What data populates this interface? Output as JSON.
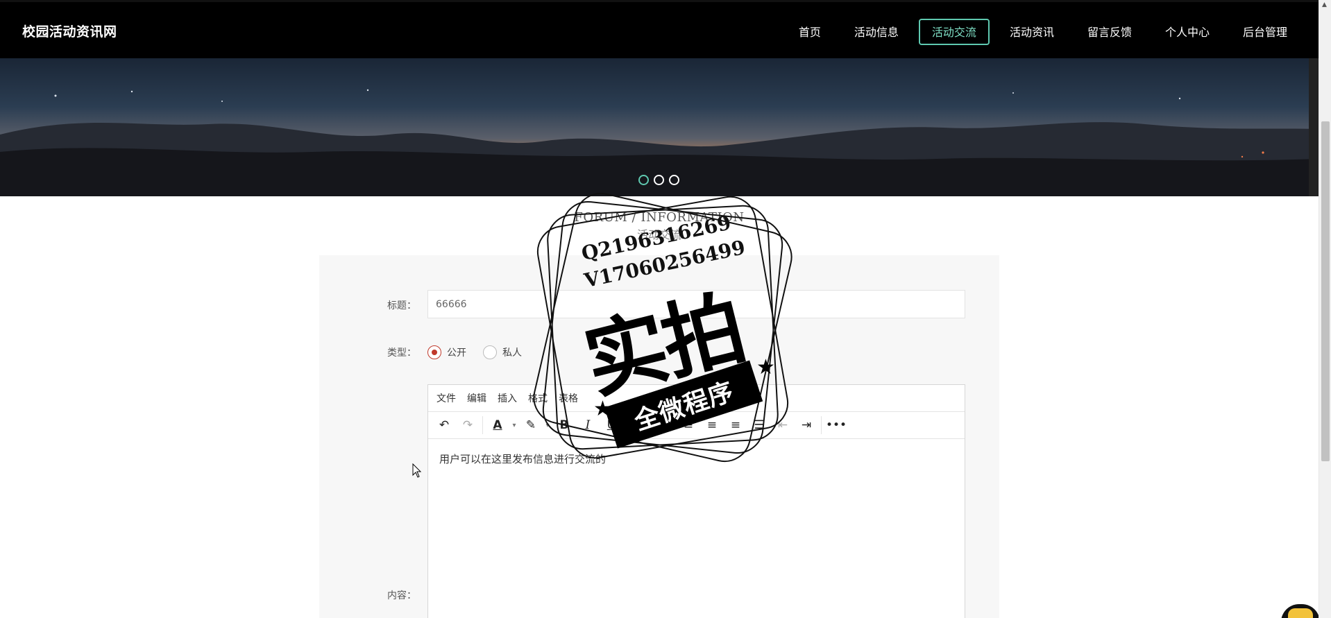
{
  "site": {
    "brand": "校园活动资讯网"
  },
  "nav": [
    {
      "label": "首页",
      "active": false
    },
    {
      "label": "活动信息",
      "active": false
    },
    {
      "label": "活动交流",
      "active": true
    },
    {
      "label": "活动资讯",
      "active": false
    },
    {
      "label": "留言反馈",
      "active": false
    },
    {
      "label": "个人中心",
      "active": false
    },
    {
      "label": "后台管理",
      "active": false
    }
  ],
  "banner": {
    "slides": 3,
    "active_slide": 1
  },
  "section": {
    "title_en": "FORUM / INFORMATION",
    "title_cn": "活动交流"
  },
  "form": {
    "title_label": "标题：",
    "title_value": "66666",
    "type_label": "类型：",
    "type_options": [
      {
        "label": "公开",
        "checked": true
      },
      {
        "label": "私人",
        "checked": false
      }
    ],
    "content_label": "内容："
  },
  "editor": {
    "menu": [
      "文件",
      "编辑",
      "插入",
      "格式",
      "表格"
    ],
    "toolbar_icons": [
      "undo-icon",
      "redo-icon",
      "text-color-icon",
      "highlight-icon",
      "bold-icon",
      "italic-icon",
      "underline-icon",
      "strikethrough-icon",
      "bullet-list-icon",
      "align-left-icon",
      "align-center-icon",
      "align-right-icon",
      "justify-icon",
      "outdent-icon",
      "indent-icon",
      "more-icon"
    ],
    "content": "用户可以在这里发布信息进行交流的"
  },
  "stamp": {
    "qq": "Q2196316269",
    "wechat": "V17060256499",
    "big_text": "实拍",
    "band_text": "全微程序"
  },
  "colors": {
    "accent": "#5fc9b0",
    "radio": "#c0392b",
    "header_bg": "#000000"
  }
}
